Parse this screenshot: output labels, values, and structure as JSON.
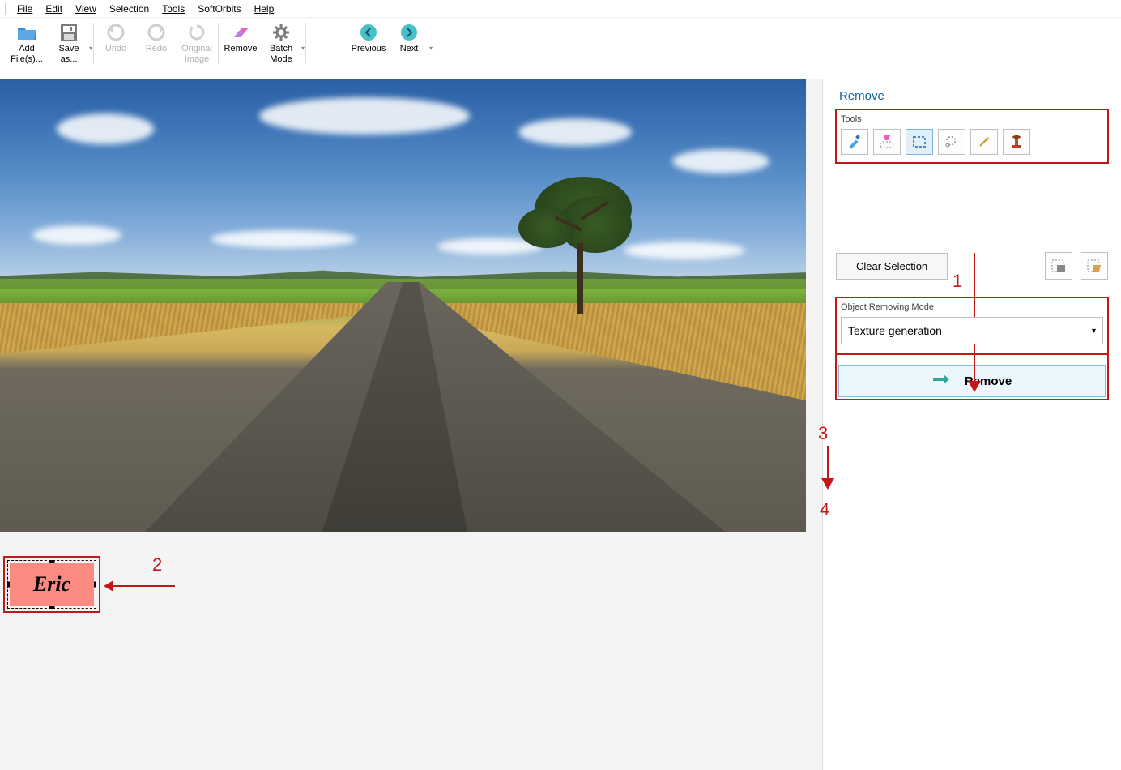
{
  "menu": {
    "file": "File",
    "edit": "Edit",
    "view": "View",
    "selection": "Selection",
    "tools": "Tools",
    "softorbits": "SoftOrbits",
    "help": "Help"
  },
  "toolbar": {
    "add_files": "Add\nFile(s)...",
    "save_as": "Save\nas...",
    "undo": "Undo",
    "redo": "Redo",
    "original_image": "Original\nImage",
    "remove": "Remove",
    "batch_mode": "Batch\nMode",
    "previous": "Previous",
    "next": "Next"
  },
  "watermark_text": "Eric",
  "panel": {
    "tab": "Remove",
    "tools_label": "Tools",
    "clear_selection": "Clear Selection",
    "mode_label": "Object Removing Mode",
    "mode_value": "Texture generation",
    "remove_button": "Remove"
  },
  "annotations": {
    "n1": "1",
    "n2": "2",
    "n3": "3",
    "n4": "4"
  }
}
